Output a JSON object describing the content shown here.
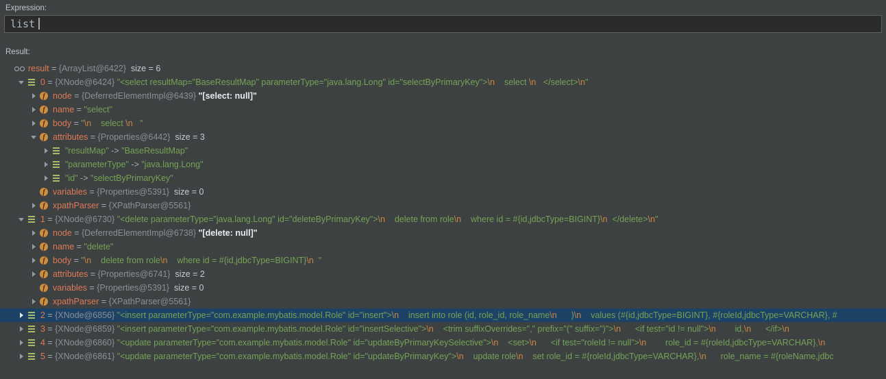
{
  "expression_panel": {
    "label": "Expression:",
    "input_value": "list"
  },
  "result_panel": {
    "label": "Result:"
  },
  "colors": {
    "background": "#3D4142",
    "input_background": "#2B2B2B",
    "selection_background": "#1E4166",
    "name_color": "#DE7A57",
    "reference_color": "#8A9096",
    "string_color": "#74A455",
    "escape_color": "#CB8742",
    "field_icon_color": "#CF8F40",
    "element_icon_color": "#A9BD6A"
  },
  "tree": {
    "rows": [
      {
        "level": 0,
        "arrow": "none",
        "icon": "result",
        "selected": false,
        "parts": [
          {
            "t": "result",
            "c": "name"
          },
          {
            "t": " = ",
            "c": "punct"
          },
          {
            "t": "{ArrayList@6422}",
            "c": "ref"
          },
          {
            "t": "  size = 6",
            "c": "plain"
          }
        ]
      },
      {
        "level": 1,
        "arrow": "down",
        "icon": "element",
        "selected": false,
        "parts": [
          {
            "t": "0",
            "c": "name"
          },
          {
            "t": " = ",
            "c": "punct"
          },
          {
            "t": "{XNode@6424}",
            "c": "ref"
          },
          {
            "t": " ",
            "c": "plain"
          },
          {
            "t": "\"<select resultMap=\"BaseResultMap\" parameterType=\"java.lang.Long\" id=\"selectByPrimaryKey\">",
            "c": "str"
          },
          {
            "t": "\\n",
            "c": "esc"
          },
          {
            "t": "    select ",
            "c": "str"
          },
          {
            "t": "\\n",
            "c": "esc"
          },
          {
            "t": "   </select>",
            "c": "str"
          },
          {
            "t": "\\n",
            "c": "esc"
          },
          {
            "t": "\"",
            "c": "str"
          }
        ]
      },
      {
        "level": 2,
        "arrow": "right",
        "icon": "field",
        "selected": false,
        "parts": [
          {
            "t": "node",
            "c": "name"
          },
          {
            "t": " = ",
            "c": "punct"
          },
          {
            "t": "{DeferredElementImpl@6439}",
            "c": "ref"
          },
          {
            "t": " ",
            "c": "plain"
          },
          {
            "t": "\"[select: null]\"",
            "c": "white"
          }
        ]
      },
      {
        "level": 2,
        "arrow": "right",
        "icon": "field",
        "selected": false,
        "parts": [
          {
            "t": "name",
            "c": "name"
          },
          {
            "t": " = ",
            "c": "punct"
          },
          {
            "t": "\"select\"",
            "c": "str"
          }
        ]
      },
      {
        "level": 2,
        "arrow": "right",
        "icon": "field",
        "selected": false,
        "parts": [
          {
            "t": "body",
            "c": "name"
          },
          {
            "t": " = ",
            "c": "punct"
          },
          {
            "t": "\"",
            "c": "str"
          },
          {
            "t": "\\n",
            "c": "esc"
          },
          {
            "t": "    select ",
            "c": "str"
          },
          {
            "t": "\\n",
            "c": "esc"
          },
          {
            "t": "   \"",
            "c": "str"
          }
        ]
      },
      {
        "level": 2,
        "arrow": "down",
        "icon": "field",
        "selected": false,
        "parts": [
          {
            "t": "attributes",
            "c": "name"
          },
          {
            "t": " = ",
            "c": "punct"
          },
          {
            "t": "{Properties@6442}",
            "c": "ref"
          },
          {
            "t": "  size = 3",
            "c": "plain"
          }
        ]
      },
      {
        "level": 3,
        "arrow": "right",
        "icon": "element",
        "selected": false,
        "parts": [
          {
            "t": "\"resultMap\"",
            "c": "str"
          },
          {
            "t": " -> ",
            "c": "punct"
          },
          {
            "t": "\"BaseResultMap\"",
            "c": "str"
          }
        ]
      },
      {
        "level": 3,
        "arrow": "right",
        "icon": "element",
        "selected": false,
        "parts": [
          {
            "t": "\"parameterType\"",
            "c": "str"
          },
          {
            "t": " -> ",
            "c": "punct"
          },
          {
            "t": "\"java.lang.Long\"",
            "c": "str"
          }
        ]
      },
      {
        "level": 3,
        "arrow": "right",
        "icon": "element",
        "selected": false,
        "parts": [
          {
            "t": "\"id\"",
            "c": "str"
          },
          {
            "t": " -> ",
            "c": "punct"
          },
          {
            "t": "\"selectByPrimaryKey\"",
            "c": "str"
          }
        ]
      },
      {
        "level": 2,
        "arrow": "none",
        "icon": "field",
        "selected": false,
        "parts": [
          {
            "t": "variables",
            "c": "name"
          },
          {
            "t": " = ",
            "c": "punct"
          },
          {
            "t": "{Properties@5391}",
            "c": "ref"
          },
          {
            "t": "  size = 0",
            "c": "plain"
          }
        ]
      },
      {
        "level": 2,
        "arrow": "right",
        "icon": "field",
        "selected": false,
        "parts": [
          {
            "t": "xpathParser",
            "c": "name"
          },
          {
            "t": " = ",
            "c": "punct"
          },
          {
            "t": "{XPathParser@5561}",
            "c": "ref"
          }
        ]
      },
      {
        "level": 1,
        "arrow": "down",
        "icon": "element",
        "selected": false,
        "parts": [
          {
            "t": "1",
            "c": "name"
          },
          {
            "t": " = ",
            "c": "punct"
          },
          {
            "t": "{XNode@6730}",
            "c": "ref"
          },
          {
            "t": " ",
            "c": "plain"
          },
          {
            "t": "\"<delete parameterType=\"java.lang.Long\" id=\"deleteByPrimaryKey\">",
            "c": "str"
          },
          {
            "t": "\\n",
            "c": "esc"
          },
          {
            "t": "    delete from role",
            "c": "str"
          },
          {
            "t": "\\n",
            "c": "esc"
          },
          {
            "t": "    where id = #{id,jdbcType=BIGINT}",
            "c": "str"
          },
          {
            "t": "\\n",
            "c": "esc"
          },
          {
            "t": "  </delete>",
            "c": "str"
          },
          {
            "t": "\\n",
            "c": "esc"
          },
          {
            "t": "\"",
            "c": "str"
          }
        ]
      },
      {
        "level": 2,
        "arrow": "right",
        "icon": "field",
        "selected": false,
        "parts": [
          {
            "t": "node",
            "c": "name"
          },
          {
            "t": " = ",
            "c": "punct"
          },
          {
            "t": "{DeferredElementImpl@6738}",
            "c": "ref"
          },
          {
            "t": " ",
            "c": "plain"
          },
          {
            "t": "\"[delete: null]\"",
            "c": "white"
          }
        ]
      },
      {
        "level": 2,
        "arrow": "right",
        "icon": "field",
        "selected": false,
        "parts": [
          {
            "t": "name",
            "c": "name"
          },
          {
            "t": " = ",
            "c": "punct"
          },
          {
            "t": "\"delete\"",
            "c": "str"
          }
        ]
      },
      {
        "level": 2,
        "arrow": "right",
        "icon": "field",
        "selected": false,
        "parts": [
          {
            "t": "body",
            "c": "name"
          },
          {
            "t": " = ",
            "c": "punct"
          },
          {
            "t": "\"",
            "c": "str"
          },
          {
            "t": "\\n",
            "c": "esc"
          },
          {
            "t": "    delete from role",
            "c": "str"
          },
          {
            "t": "\\n",
            "c": "esc"
          },
          {
            "t": "    where id = #{id,jdbcType=BIGINT}",
            "c": "str"
          },
          {
            "t": "\\n",
            "c": "esc"
          },
          {
            "t": "  \"",
            "c": "str"
          }
        ]
      },
      {
        "level": 2,
        "arrow": "right",
        "icon": "field",
        "selected": false,
        "parts": [
          {
            "t": "attributes",
            "c": "name"
          },
          {
            "t": " = ",
            "c": "punct"
          },
          {
            "t": "{Properties@6741}",
            "c": "ref"
          },
          {
            "t": "  size = 2",
            "c": "plain"
          }
        ]
      },
      {
        "level": 2,
        "arrow": "none",
        "icon": "field",
        "selected": false,
        "parts": [
          {
            "t": "variables",
            "c": "name"
          },
          {
            "t": " = ",
            "c": "punct"
          },
          {
            "t": "{Properties@5391}",
            "c": "ref"
          },
          {
            "t": "  size = 0",
            "c": "plain"
          }
        ]
      },
      {
        "level": 2,
        "arrow": "right",
        "icon": "field",
        "selected": false,
        "parts": [
          {
            "t": "xpathParser",
            "c": "name"
          },
          {
            "t": " = ",
            "c": "punct"
          },
          {
            "t": "{XPathParser@5561}",
            "c": "ref"
          }
        ]
      },
      {
        "level": 1,
        "arrow": "right",
        "icon": "element",
        "selected": true,
        "parts": [
          {
            "t": "2",
            "c": "name"
          },
          {
            "t": " = ",
            "c": "punct"
          },
          {
            "t": "{XNode@6856}",
            "c": "ref"
          },
          {
            "t": " ",
            "c": "plain"
          },
          {
            "t": "\"<insert parameterType=\"com.example.mybatis.model.Role\" id=\"insert\">",
            "c": "str"
          },
          {
            "t": "\\n",
            "c": "esc"
          },
          {
            "t": "    insert into role (id, role_id, role_name",
            "c": "str"
          },
          {
            "t": "\\n",
            "c": "esc"
          },
          {
            "t": "      )",
            "c": "str"
          },
          {
            "t": "\\n",
            "c": "esc"
          },
          {
            "t": "    values (#{id,jdbcType=BIGINT}, #{roleId,jdbcType=VARCHAR}, #",
            "c": "str"
          }
        ]
      },
      {
        "level": 1,
        "arrow": "right",
        "icon": "element",
        "selected": false,
        "parts": [
          {
            "t": "3",
            "c": "name"
          },
          {
            "t": " = ",
            "c": "punct"
          },
          {
            "t": "{XNode@6859}",
            "c": "ref"
          },
          {
            "t": " ",
            "c": "plain"
          },
          {
            "t": "\"<insert parameterType=\"com.example.mybatis.model.Role\" id=\"insertSelective\">",
            "c": "str"
          },
          {
            "t": "\\n",
            "c": "esc"
          },
          {
            "t": "    <trim suffixOverrides=\",\" prefix=\"(\" suffix=\")\">",
            "c": "str"
          },
          {
            "t": "\\n",
            "c": "esc"
          },
          {
            "t": "      <if test=\"id != null\">",
            "c": "str"
          },
          {
            "t": "\\n",
            "c": "esc"
          },
          {
            "t": "        id,",
            "c": "str"
          },
          {
            "t": "\\n",
            "c": "esc"
          },
          {
            "t": "      </if>",
            "c": "str"
          },
          {
            "t": "\\n",
            "c": "esc"
          }
        ]
      },
      {
        "level": 1,
        "arrow": "right",
        "icon": "element",
        "selected": false,
        "parts": [
          {
            "t": "4",
            "c": "name"
          },
          {
            "t": " = ",
            "c": "punct"
          },
          {
            "t": "{XNode@6860}",
            "c": "ref"
          },
          {
            "t": " ",
            "c": "plain"
          },
          {
            "t": "\"<update parameterType=\"com.example.mybatis.model.Role\" id=\"updateByPrimaryKeySelective\">",
            "c": "str"
          },
          {
            "t": "\\n",
            "c": "esc"
          },
          {
            "t": "    <set>",
            "c": "str"
          },
          {
            "t": "\\n",
            "c": "esc"
          },
          {
            "t": "      <if test=\"roleId != null\">",
            "c": "str"
          },
          {
            "t": "\\n",
            "c": "esc"
          },
          {
            "t": "        role_id = #{roleId,jdbcType=VARCHAR},",
            "c": "str"
          },
          {
            "t": "\\n",
            "c": "esc"
          }
        ]
      },
      {
        "level": 1,
        "arrow": "right",
        "icon": "element",
        "selected": false,
        "parts": [
          {
            "t": "5",
            "c": "name"
          },
          {
            "t": " = ",
            "c": "punct"
          },
          {
            "t": "{XNode@6861}",
            "c": "ref"
          },
          {
            "t": " ",
            "c": "plain"
          },
          {
            "t": "\"<update parameterType=\"com.example.mybatis.model.Role\" id=\"updateByPrimaryKey\">",
            "c": "str"
          },
          {
            "t": "\\n",
            "c": "esc"
          },
          {
            "t": "    update role",
            "c": "str"
          },
          {
            "t": "\\n",
            "c": "esc"
          },
          {
            "t": "    set role_id = #{roleId,jdbcType=VARCHAR},",
            "c": "str"
          },
          {
            "t": "\\n",
            "c": "esc"
          },
          {
            "t": "      role_name = #{roleName,jdbc",
            "c": "str"
          }
        ]
      }
    ]
  }
}
